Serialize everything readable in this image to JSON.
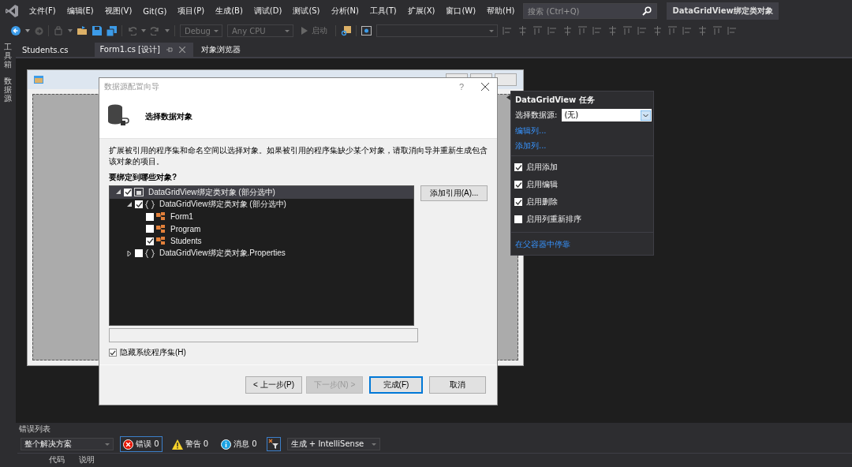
{
  "menu": [
    "文件(F)",
    "编辑(E)",
    "视图(V)",
    "Git(G)",
    "项目(P)",
    "生成(B)",
    "调试(D)",
    "测试(S)",
    "分析(N)",
    "工具(T)",
    "扩展(X)",
    "窗口(W)",
    "帮助(H)"
  ],
  "search": {
    "placeholder": "搜索 (Ctrl+Q)"
  },
  "solution_title": "DataGridView绑定类对象",
  "toolbar": {
    "configuration": "Debug",
    "platform": "Any CPU",
    "start": "启动"
  },
  "side_tabs": [
    "工具箱",
    "数据源"
  ],
  "doc_tabs": [
    {
      "label": "Students.cs",
      "selected": false
    },
    {
      "label": "Form1.cs [设计]",
      "selected": true
    },
    {
      "label": "对象浏览器",
      "selected": false
    }
  ],
  "dialog": {
    "title": "数据源配置向导",
    "help": "?",
    "heading": "选择数据对象",
    "description": "扩展被引用的程序集和命名空间以选择对象。如果被引用的程序集缺少某个对象，请取消向导并重新生成包含该对象的项目。",
    "tree_label": "要绑定到哪些对象?",
    "tree": [
      {
        "label": "DataGridView绑定类对象 (部分选中)",
        "kind": "assembly",
        "checked": true,
        "expanded": true,
        "selected": true,
        "children": [
          {
            "label": "DataGridView绑定类对象 (部分选中)",
            "kind": "namespace",
            "checked": true,
            "expanded": true,
            "selected": false,
            "children": [
              {
                "label": "Form1",
                "kind": "class",
                "checked": false,
                "selected": false
              },
              {
                "label": "Program",
                "kind": "class",
                "checked": false,
                "selected": false
              },
              {
                "label": "Students",
                "kind": "class",
                "checked": true,
                "selected": false
              }
            ]
          },
          {
            "label": "DataGridView绑定类对象.Properties",
            "kind": "namespace",
            "checked": false,
            "expanded": false,
            "selected": false
          }
        ]
      }
    ],
    "add_reference": "添加引用(A)...",
    "hide_system": {
      "label": "隐藏系统程序集(H)",
      "checked": true
    },
    "buttons": [
      {
        "label": "< 上一步(P)",
        "disabled": false,
        "default": false
      },
      {
        "label": "下一步(N) >",
        "disabled": true,
        "default": false
      },
      {
        "label": "完成(F)",
        "disabled": false,
        "default": true
      },
      {
        "label": "取消",
        "disabled": false,
        "default": false
      }
    ]
  },
  "tasks_panel": {
    "title": "DataGridView 任务",
    "source_label": "选择数据源:",
    "source_value": "(无)",
    "links_top": [
      "编辑列...",
      "添加列..."
    ],
    "options": [
      {
        "label": "启用添加",
        "checked": true
      },
      {
        "label": "启用编辑",
        "checked": true
      },
      {
        "label": "启用删除",
        "checked": true
      },
      {
        "label": "启用列重新排序",
        "checked": false
      }
    ],
    "link_bottom": "在父容器中停靠"
  },
  "error_list": {
    "title": "错误列表",
    "scope": "整个解决方案",
    "errors": "错误 0",
    "warnings": "警告 0",
    "messages": "消息 0",
    "build": "生成 + IntelliSense",
    "columns": [
      "代码",
      "说明"
    ]
  }
}
